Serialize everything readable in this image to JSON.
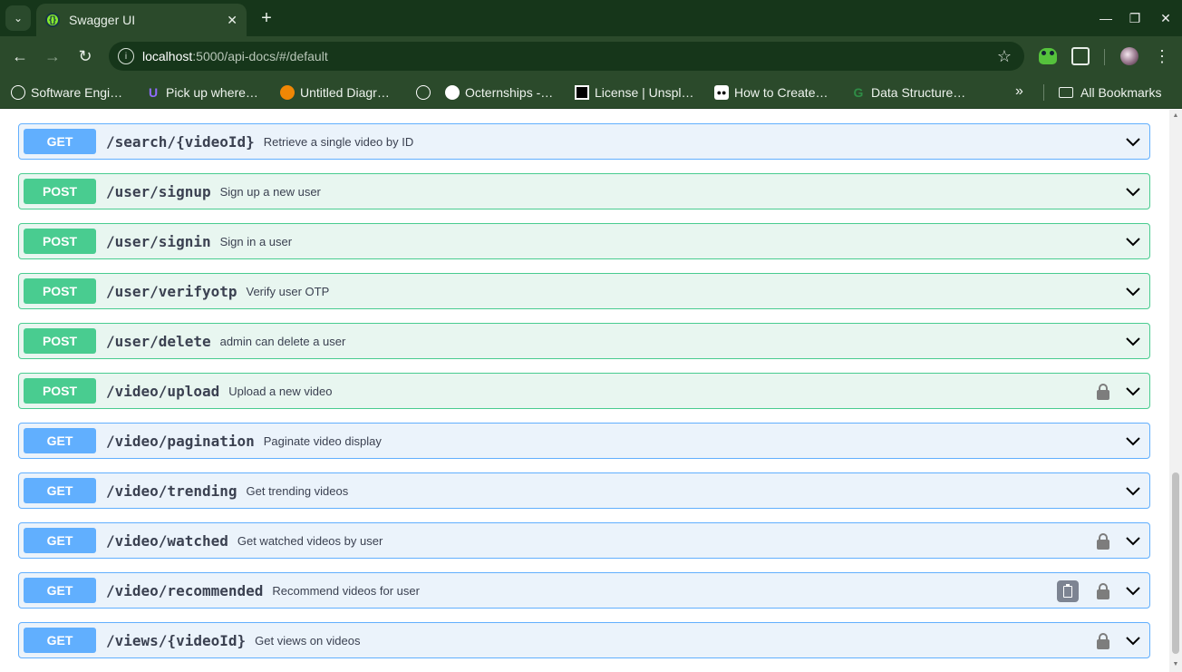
{
  "browser": {
    "tab_title": "Swagger UI",
    "tab_favicon_glyph": "{}",
    "url_host": "localhost",
    "url_rest": ":5000/api-docs/#/default",
    "bookmarks": [
      {
        "label": "Software Engi…",
        "icon": "openai-icon",
        "color": "#ffffff"
      },
      {
        "label": "Pick up where…",
        "icon": "udemy-icon",
        "color": "#5624d0"
      },
      {
        "label": "Untitled Diagr…",
        "icon": "drawio-icon",
        "color": "#f08705"
      },
      {
        "label": "",
        "icon": "globe-icon",
        "color": "#ffffff"
      },
      {
        "label": "Octernships -…",
        "icon": "github-icon",
        "color": "#ffffff"
      },
      {
        "label": "License | Unspl…",
        "icon": "unsplash-icon",
        "color": "#000000"
      },
      {
        "label": "How to Create…",
        "icon": "medium-icon",
        "color": "#000000"
      },
      {
        "label": "Data Structure…",
        "icon": "gfg-icon",
        "color": "#2f8d46"
      }
    ],
    "all_bookmarks_label": "All Bookmarks",
    "more_glyph": "»"
  },
  "operations": [
    {
      "method": "GET",
      "path": "/search/{videoId}",
      "summary": "Retrieve a single video by ID",
      "locked": false,
      "copy": false
    },
    {
      "method": "POST",
      "path": "/user/signup",
      "summary": "Sign up a new user",
      "locked": false,
      "copy": false
    },
    {
      "method": "POST",
      "path": "/user/signin",
      "summary": "Sign in a user",
      "locked": false,
      "copy": false
    },
    {
      "method": "POST",
      "path": "/user/verifyotp",
      "summary": "Verify user OTP",
      "locked": false,
      "copy": false
    },
    {
      "method": "POST",
      "path": "/user/delete",
      "summary": "admin can delete a user",
      "locked": false,
      "copy": false
    },
    {
      "method": "POST",
      "path": "/video/upload",
      "summary": "Upload a new video",
      "locked": true,
      "copy": false
    },
    {
      "method": "GET",
      "path": "/video/pagination",
      "summary": "Paginate video display",
      "locked": false,
      "copy": false
    },
    {
      "method": "GET",
      "path": "/video/trending",
      "summary": "Get trending videos",
      "locked": false,
      "copy": false
    },
    {
      "method": "GET",
      "path": "/video/watched",
      "summary": "Get watched videos by user",
      "locked": true,
      "copy": false
    },
    {
      "method": "GET",
      "path": "/video/recommended",
      "summary": "Recommend videos for user",
      "locked": true,
      "copy": true
    },
    {
      "method": "GET",
      "path": "/views/{videoId}",
      "summary": "Get views on videos",
      "locked": true,
      "copy": false
    }
  ],
  "colors": {
    "get_bg": "#ebf3fb",
    "get_accent": "#61affe",
    "post_bg": "#e8f6f0",
    "post_accent": "#49cc90",
    "chrome_dark": "#16361a",
    "chrome_mid": "#2b4a2b"
  }
}
